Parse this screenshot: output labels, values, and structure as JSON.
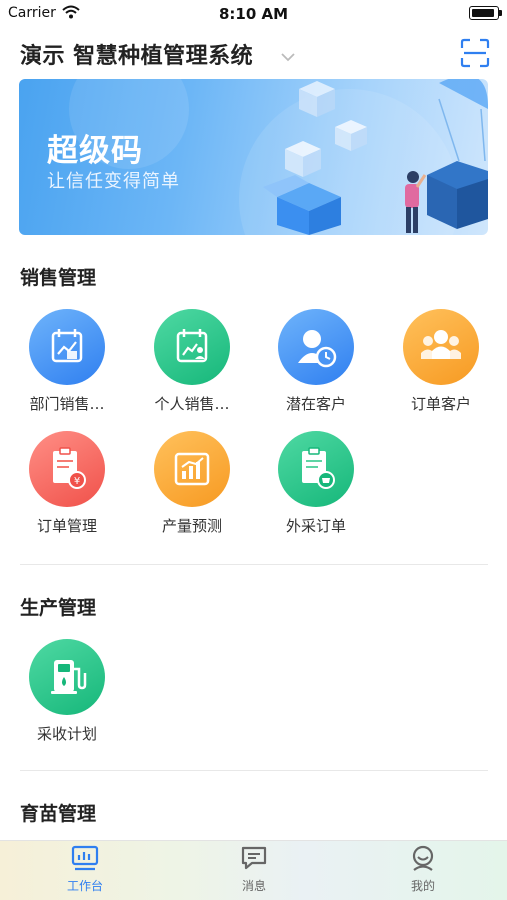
{
  "status_bar": {
    "carrier": "Carrier",
    "time": "8:10 AM",
    "battery_level": 1.0
  },
  "header": {
    "title": "演示 智慧种植管理系统"
  },
  "banner": {
    "title": "超级码",
    "subtitle": "让信任变得简单"
  },
  "sections": [
    {
      "title": "销售管理",
      "items": [
        {
          "label": "部门销售…",
          "icon": "department-sales-icon",
          "color": "#3a8cf2"
        },
        {
          "label": "个人销售…",
          "icon": "personal-sales-icon",
          "color": "#1fbd82"
        },
        {
          "label": "潜在客户",
          "icon": "potential-customer-icon",
          "color": "#3a8cf2"
        },
        {
          "label": "订单客户",
          "icon": "order-customer-icon",
          "color": "#f79a22"
        },
        {
          "label": "订单管理",
          "icon": "order-management-icon",
          "color": "#f0514a"
        },
        {
          "label": "产量预测",
          "icon": "yield-forecast-icon",
          "color": "#f79a22"
        },
        {
          "label": "外采订单",
          "icon": "external-purchase-icon",
          "color": "#1fbd82"
        }
      ]
    },
    {
      "title": "生产管理",
      "items": [
        {
          "label": "采收计划",
          "icon": "harvest-plan-icon",
          "color": "#1fbd82"
        }
      ]
    },
    {
      "title": "育苗管理",
      "items": []
    }
  ],
  "tabbar": {
    "active_color": "#2f7ff0",
    "tabs": [
      {
        "label": "工作台",
        "icon": "dashboard-icon",
        "active": true
      },
      {
        "label": "消息",
        "icon": "message-icon",
        "active": false
      },
      {
        "label": "我的",
        "icon": "profile-icon",
        "active": false
      }
    ]
  }
}
